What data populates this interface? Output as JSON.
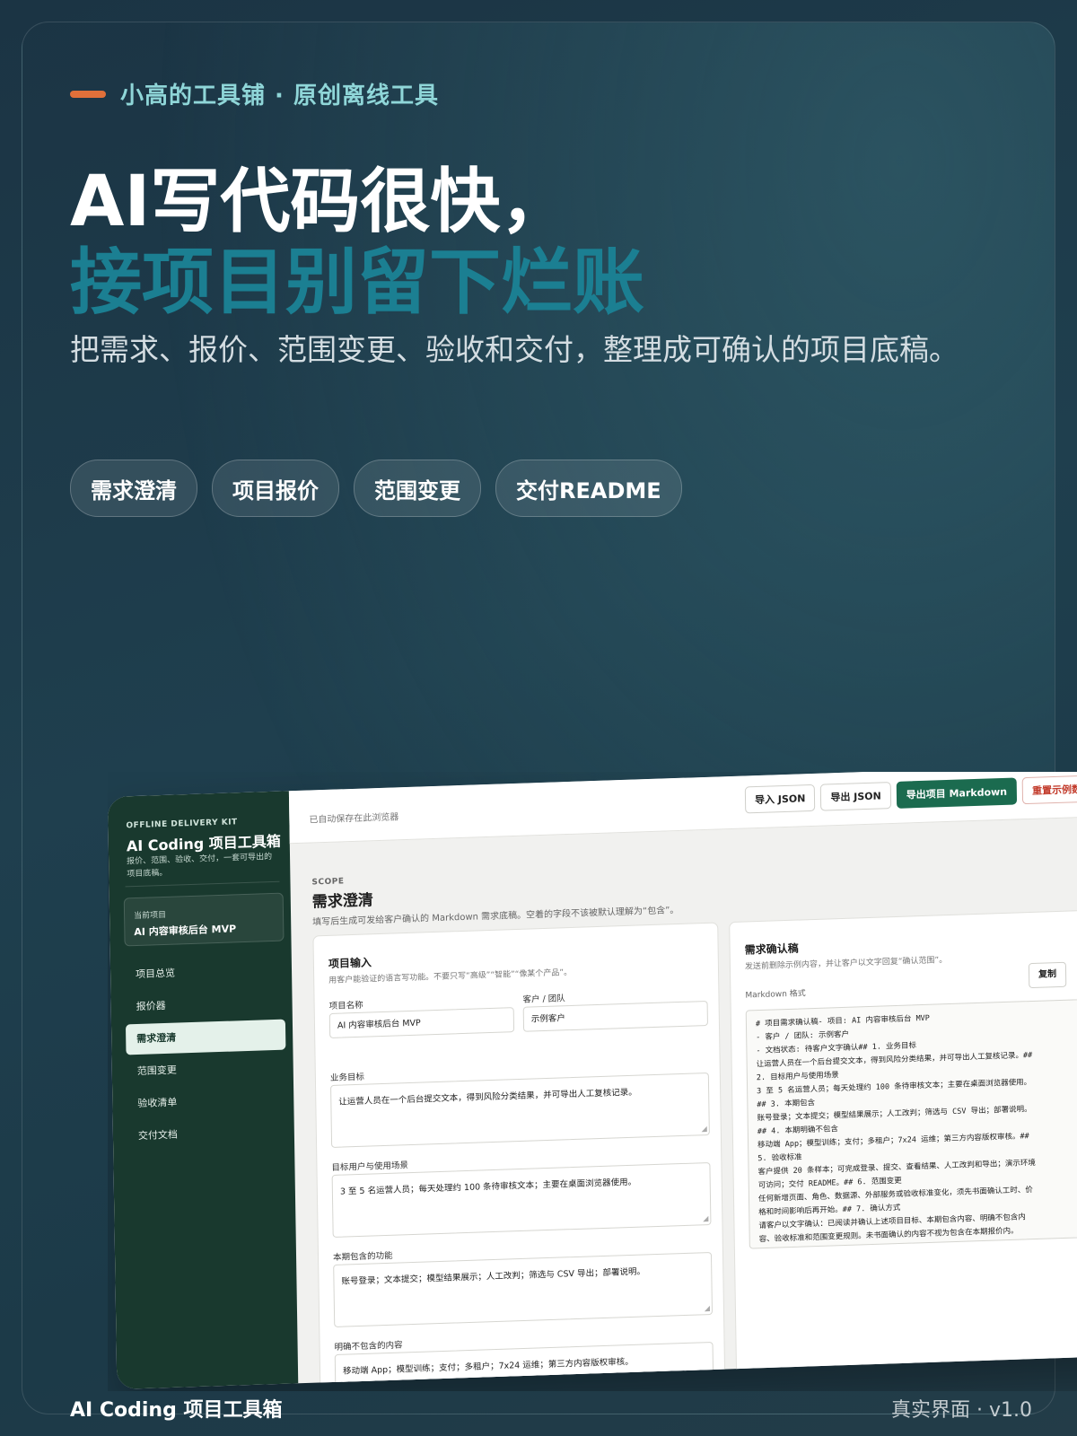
{
  "promo": {
    "eyebrow": "小高的工具铺 · 原创离线工具",
    "headline_line1": "AI写代码很快，",
    "headline_line2": "接项目别留下烂账",
    "subtitle": "把需求、报价、范围变更、验收和交付，整理成可确认的项目底稿。",
    "chips": [
      "需求澄清",
      "项目报价",
      "范围变更",
      "交付README"
    ],
    "footer_left": "AI Coding 项目工具箱",
    "footer_right": "真实界面 · v1.0",
    "accent_color": "#e0703a",
    "headline_accent_color": "#1b7f92"
  },
  "app": {
    "sidebar": {
      "kicker": "OFFLINE DELIVERY KIT",
      "title": "AI Coding 项目工具箱",
      "description": "报价、范围、验收、交付，一套可导出的项目底稿。",
      "current_project_label": "当前项目",
      "current_project_name": "AI 内容审核后台 MVP",
      "nav": [
        "项目总览",
        "报价器",
        "需求澄清",
        "范围变更",
        "验收清单",
        "交付文档"
      ],
      "active_nav": "需求澄清"
    },
    "topbar": {
      "autosave": "已自动保存在此浏览器",
      "import_json": "导入 JSON",
      "export_json": "导出 JSON",
      "export_markdown": "导出项目 Markdown",
      "reset_sample": "重置示例数据"
    },
    "section": {
      "kicker": "SCOPE",
      "title": "需求澄清",
      "description": "填写后生成可发给客户确认的 Markdown 需求底稿。空着的字段不该被默认理解为“包含”。"
    },
    "form": {
      "title": "项目输入",
      "description": "用客户能验证的语言写功能。不要只写“高级”“智能”“像某个产品”。",
      "project_name_label": "项目名称",
      "project_name_value": "AI 内容审核后台 MVP",
      "client_label": "客户 / 团队",
      "client_value": "示例客户",
      "goal_label": "业务目标",
      "goal_value": "让运营人员在一个后台提交文本，得到风险分类结果，并可导出人工复核记录。",
      "users_label": "目标用户与使用场景",
      "users_value": "3 至 5 名运营人员；每天处理约 100 条待审核文本；主要在桌面浏览器使用。",
      "included_label": "本期包含的功能",
      "included_value": "账号登录；文本提交；模型结果展示；人工改判；筛选与 CSV 导出；部署说明。",
      "excluded_label": "明确不包含的内容",
      "excluded_value": "移动端 App；模型训练；支付；多租户；7x24 运维；第三方内容版权审核。"
    },
    "preview": {
      "title": "需求确认稿",
      "description": "发送前删除示例内容，并让客户以文字回复“确认范围”。",
      "format_label": "Markdown 格式",
      "copy_label": "复制",
      "markdown_lines": [
        "# 项目需求确认稿- 项目: AI 内容审核后台 MVP",
        "- 客户 / 团队: 示例客户",
        "- 文档状态: 待客户文字确认## 1. 业务目标",
        "让运营人员在一个后台提交文本，得到风险分类结果，并可导出人工复核记录。##",
        "2. 目标用户与使用场景",
        "3 至 5 名运营人员；每天处理约 100 条待审核文本；主要在桌面浏览器使用。",
        "## 3. 本期包含",
        "账号登录；文本提交；模型结果展示；人工改判；筛选与 CSV 导出；部署说明。",
        "## 4. 本期明确不包含",
        "移动端 App；模型训练；支付；多租户；7x24 运维；第三方内容版权审核。##",
        "5. 验收标准",
        "客户提供 20 条样本；可完成登录、提交、查看结果、人工改判和导出；演示环境",
        "可访问；交付 README。## 6. 范围变更",
        "任何新增页面、角色、数据源、外部服务或验收标准变化，须先书面确认工时、价",
        "格和时间影响后再开始。## 7. 确认方式",
        "请客户以文字确认：已阅读并确认上述项目目标、本期包含内容、明确不包含内",
        "容、验收标准和范围变更规则。未书面确认的内容不视为包含在本期报价内。"
      ]
    }
  }
}
